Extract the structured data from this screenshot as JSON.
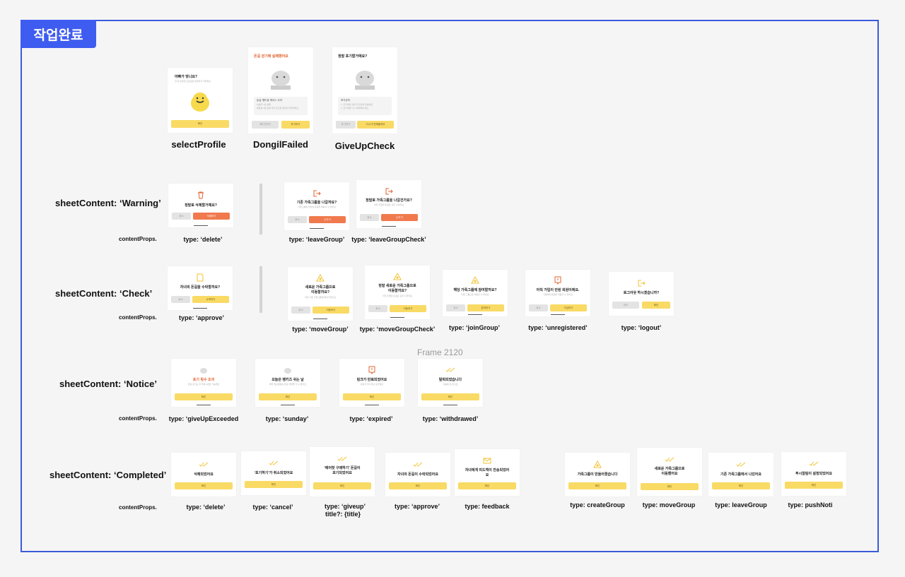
{
  "badge": "작업완료",
  "top": {
    "selectProfile": {
      "title": "아빠가 맞나요?",
      "sub": "한 번 설정한 프로필은 변경하기 어려워요",
      "btn": "확인",
      "label": "selectProfile"
    },
    "dongilFailed": {
      "title": "돈길 걷기에 실패했어요",
      "box1": "돈길 '핸드폰 케이스 사자'",
      "box2": "이번주 1번 실패",
      "box3": "목표를 3번 넘게 하지 않으면 원금이 되돌려져요",
      "btn1": "재도전하기",
      "btn2": "포기하기",
      "label": "DongilFailed"
    },
    "giveUpCheck": {
      "title": "정말 포기할거에요?",
      "box1": "포기규칙",
      "box2": "1. 포기하면 이번 주 돈길이 무효에요",
      "box3": "2. 포기하면 다시 계약해야 해요",
      "btn1": "포기하기",
      "btn2": "다시 도전해볼게요",
      "label": "GiveUpCheck"
    }
  },
  "warning": {
    "header": "sheetContent: ‘Warning’",
    "cp": "contentProps.",
    "delete": {
      "title": "정말로 삭제할거예요?",
      "b1": "취소",
      "b2": "삭제하기",
      "label": "type: ‘delete’"
    },
    "leaveGroup": {
      "title": "기존 가족그룹을 나갈까요?",
      "sub": "가족그룹에 있어야 돈길을 계속할 수 있어요",
      "b1": "취소",
      "b2": "나가기",
      "label": "type: ‘leaveGroup’"
    },
    "leaveGroupCheck": {
      "title": "정말로 가족그룹을 나갈건가요?",
      "sub": "이전 진행한 돈길은 모두 사라져요",
      "b1": "취소",
      "b2": "나가기",
      "label": "type: ‘leaveGroupCheck’"
    }
  },
  "check": {
    "header": "sheetContent: ‘Check’",
    "cp": "contentProps.",
    "approve": {
      "title": "자녀의 돈길을 수락할까요?",
      "b1": "취소",
      "b2": "수락하기",
      "label": "type: ‘approve’"
    },
    "moveGroup": {
      "title": "새로운 가족그룹으로",
      "title2": "이동할까요?",
      "sub": "이전 기존 가족그룹에 들어가있어요",
      "b1": "취소",
      "b2": "이동하기",
      "label": "type: ‘moveGroup’"
    },
    "moveGroupCheck": {
      "title": "정말 새로운 가족그룹으로",
      "title2": "이동할까요?",
      "sub": "이전 진행한 돈길은 모두 사라져요",
      "b1": "취소",
      "b2": "이동하기",
      "label": "type: ‘moveGroupCheck’"
    },
    "joinGroup": {
      "title": "해당 가족그룹에 참여할까요?",
      "sub": "다른 그룹으로 이동할 수 있어요",
      "b1": "취소",
      "b2": "참여하기",
      "label": "type: ‘joinGroup’"
    },
    "unregistered": {
      "title": "아직 가입이 안된 회원이에요.",
      "sub": "가입하면 돈길을 이용할 수 있어요",
      "b1": "취소",
      "b2": "가입하기",
      "label": "type: ‘unregistered’"
    },
    "logout": {
      "title": "로그아웃 하시겠습니까?",
      "b1": "취소",
      "b2": "확인",
      "label": "type: ‘logout’"
    }
  },
  "frameName": "Frame 2120",
  "notice": {
    "header": "sheetContent: ‘Notice’",
    "cp": "contentProps.",
    "giveUpExceeded": {
      "title": "포기 횟수 초과",
      "sub": "돈길 포기는 한 주에 1번만 가능해요",
      "btn": "확인",
      "label": "type: ‘giveUpExceeded"
    },
    "sunday": {
      "title": "오늘은 뱅키즈 쉬는 날",
      "sub": "매주 일요일에는 돈길 계약을 할 수 없어요",
      "btn": "확인",
      "label": "type: ‘sunday’"
    },
    "expired": {
      "title": "링크가 만료되었어요",
      "sub": "유효기간이 지난 링크예요",
      "btn": "확인",
      "label": "type: ‘expired’"
    },
    "withdrawed": {
      "title": "탈퇴되었습니다",
      "sub": "다음에 또 만나요",
      "btn": "확인",
      "label": "type: ‘withdrawed’"
    }
  },
  "completed": {
    "header": "sheetContent: ‘Completed’",
    "cp": "contentProps.",
    "delete": {
      "title": "삭제되었어요",
      "btn": "확인",
      "label": "type: ‘delete’"
    },
    "cancel": {
      "title": "‘포기하기’가 취소되었어요",
      "btn": "확인",
      "label": "type: ‘cancel’"
    },
    "giveup": {
      "title": "‘에어팟 구매하기’ 돈길이",
      "title2": "포기되었어요",
      "btn": "확인",
      "label": "type: ‘giveup’",
      "label2": "title?: {title}"
    },
    "approve": {
      "title": "자녀의 돈길이 수락되었어요",
      "btn": "확인",
      "label": "type: ‘approve’"
    },
    "feedback": {
      "title": "자녀에게 피드백이 전송되었어",
      "title2": "요",
      "btn": "확인",
      "label": "type: feedback"
    },
    "createGroup": {
      "title": "가족그룹이 만들어졌습니다",
      "btn": "확인",
      "label": "type: createGroup"
    },
    "moveGroup": {
      "title": "새로운 가족그룹으로",
      "title2": "이동했어요",
      "btn": "확인",
      "label": "type: moveGroup"
    },
    "leaveGroup": {
      "title": "기존 가족그룹에서 나갔어요",
      "btn": "확인",
      "label": "type: leaveGroup"
    },
    "pushNoti": {
      "title": "푸시알림이 설정되었어요",
      "btn": "확인",
      "label": "type: pushNoti"
    }
  }
}
